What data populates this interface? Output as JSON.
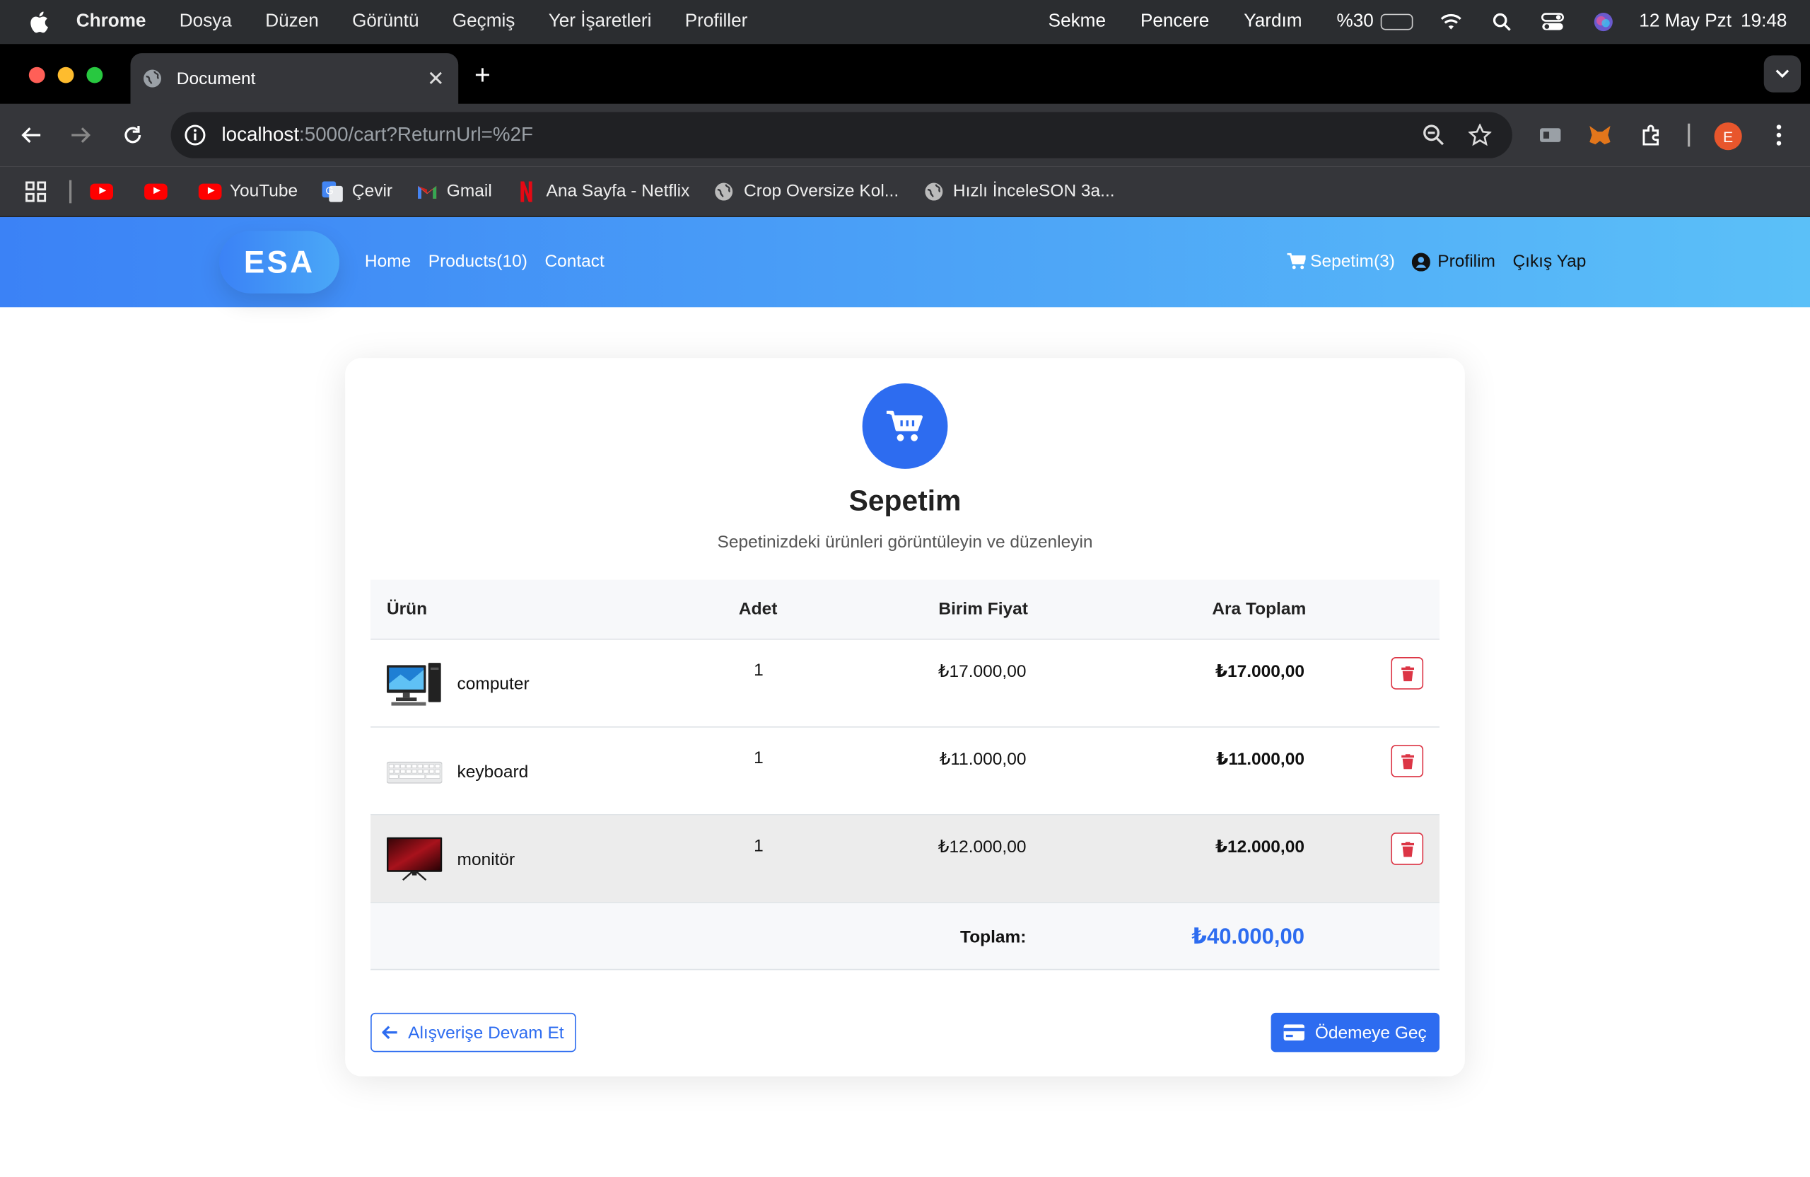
{
  "menubar": {
    "app": "Chrome",
    "items": [
      "Dosya",
      "Düzen",
      "Görüntü",
      "Geçmiş",
      "Yer İşaretleri",
      "Profiller"
    ],
    "right_items": [
      "Sekme",
      "Pencere",
      "Yardım"
    ],
    "battery": "%30",
    "battery_level": 0.3,
    "date": "12 May Pzt",
    "time": "19:48"
  },
  "browser": {
    "tab_title": "Document",
    "url_host": "localhost",
    "url_rest": ":5000/cart?ReturnUrl=%2F",
    "profile_initial": "E",
    "bookmarks": [
      {
        "label": "",
        "icon": "youtube-icon"
      },
      {
        "label": "",
        "icon": "youtube-icon"
      },
      {
        "label": "YouTube",
        "icon": "youtube-icon"
      },
      {
        "label": "Çevir",
        "icon": "translate-icon"
      },
      {
        "label": "Gmail",
        "icon": "gmail-icon"
      },
      {
        "label": "Ana Sayfa - Netflix",
        "icon": "netflix-icon"
      },
      {
        "label": "Crop Oversize Kol...",
        "icon": "globe-icon"
      },
      {
        "label": "Hızlı İnceleSON 3a...",
        "icon": "globe-icon"
      }
    ]
  },
  "site": {
    "logo": "ESA",
    "nav": [
      "Home",
      "Products(10)",
      "Contact"
    ],
    "cart_link": "Sepetim(3)",
    "profile_link": "Profilim",
    "logout_link": "Çıkış Yap"
  },
  "cart": {
    "title": "Sepetim",
    "subtitle": "Sepetinizdeki ürünleri görüntüleyin ve düzenleyin",
    "headers": {
      "product": "Ürün",
      "qty": "Adet",
      "unit_price": "Birim Fiyat",
      "subtotal": "Ara Toplam"
    },
    "items": [
      {
        "name": "computer",
        "qty": "1",
        "unit_price": "₺17.000,00",
        "subtotal": "₺17.000,00"
      },
      {
        "name": "keyboard",
        "qty": "1",
        "unit_price": "₺11.000,00",
        "subtotal": "₺11.000,00"
      },
      {
        "name": "monitör",
        "qty": "1",
        "unit_price": "₺12.000,00",
        "subtotal": "₺12.000,00"
      }
    ],
    "total_label": "Toplam:",
    "total": "₺40.000,00",
    "continue_label": "Alışverişe Devam Et",
    "checkout_label": "Ödemeye Geç"
  },
  "colors": {
    "primary": "#2d6cf0",
    "danger": "#dc3545",
    "nav_gradient_start": "#3b82f6",
    "nav_gradient_end": "#5bc0f8"
  }
}
